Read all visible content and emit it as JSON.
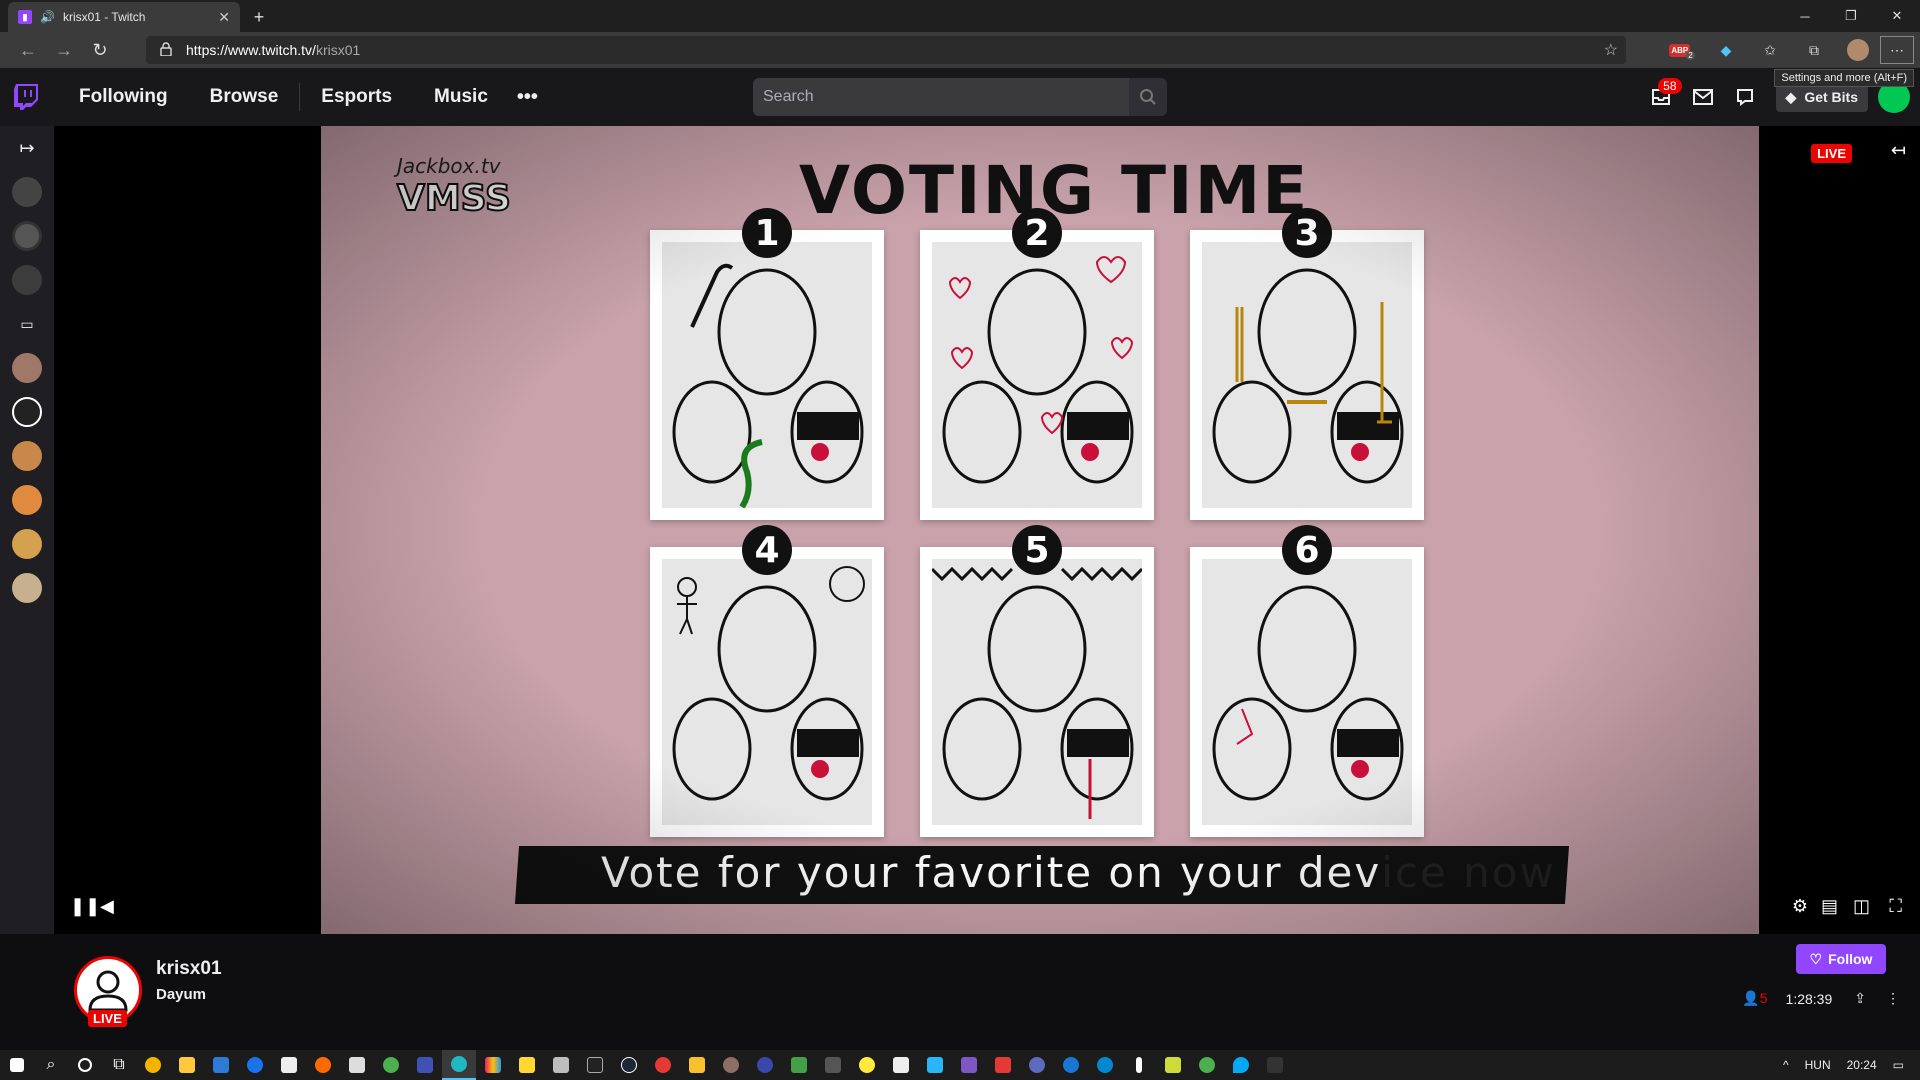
{
  "browser": {
    "tab_title": "krisx01 - Twitch",
    "url_host": "https://www.twitch.tv/",
    "url_path": "krisx01",
    "tooltip": "Settings and more (Alt+F)",
    "new_tab": "+",
    "ext_abp_count": "2"
  },
  "twitch_nav": {
    "links": [
      "Following",
      "Browse",
      "Esports",
      "Music"
    ],
    "more": "•••",
    "search_placeholder": "Search",
    "notification_count": "58",
    "get_bits": "Get Bits"
  },
  "stream": {
    "overlay_brand": "Jackbox.tv",
    "overlay_game": "VMSS",
    "heading": "VOTING TIME",
    "card_numbers": [
      "1",
      "2",
      "3",
      "4",
      "5",
      "6"
    ],
    "banner_text_visible": "Vote for your favorite on your dev",
    "banner_text_rest": "ice now",
    "live_label": "LIVE"
  },
  "channel": {
    "name": "krisx01",
    "title": "Dayum",
    "live_label": "LIVE",
    "follow_label": "Follow",
    "viewers": "5",
    "uptime": "1:28:39"
  },
  "taskbar": {
    "language": "HUN",
    "time": "20:24"
  },
  "colors": {
    "twitch_purple": "#9147ff",
    "live_red": "#eb0400",
    "stage_pink": "#c9a2ab"
  }
}
